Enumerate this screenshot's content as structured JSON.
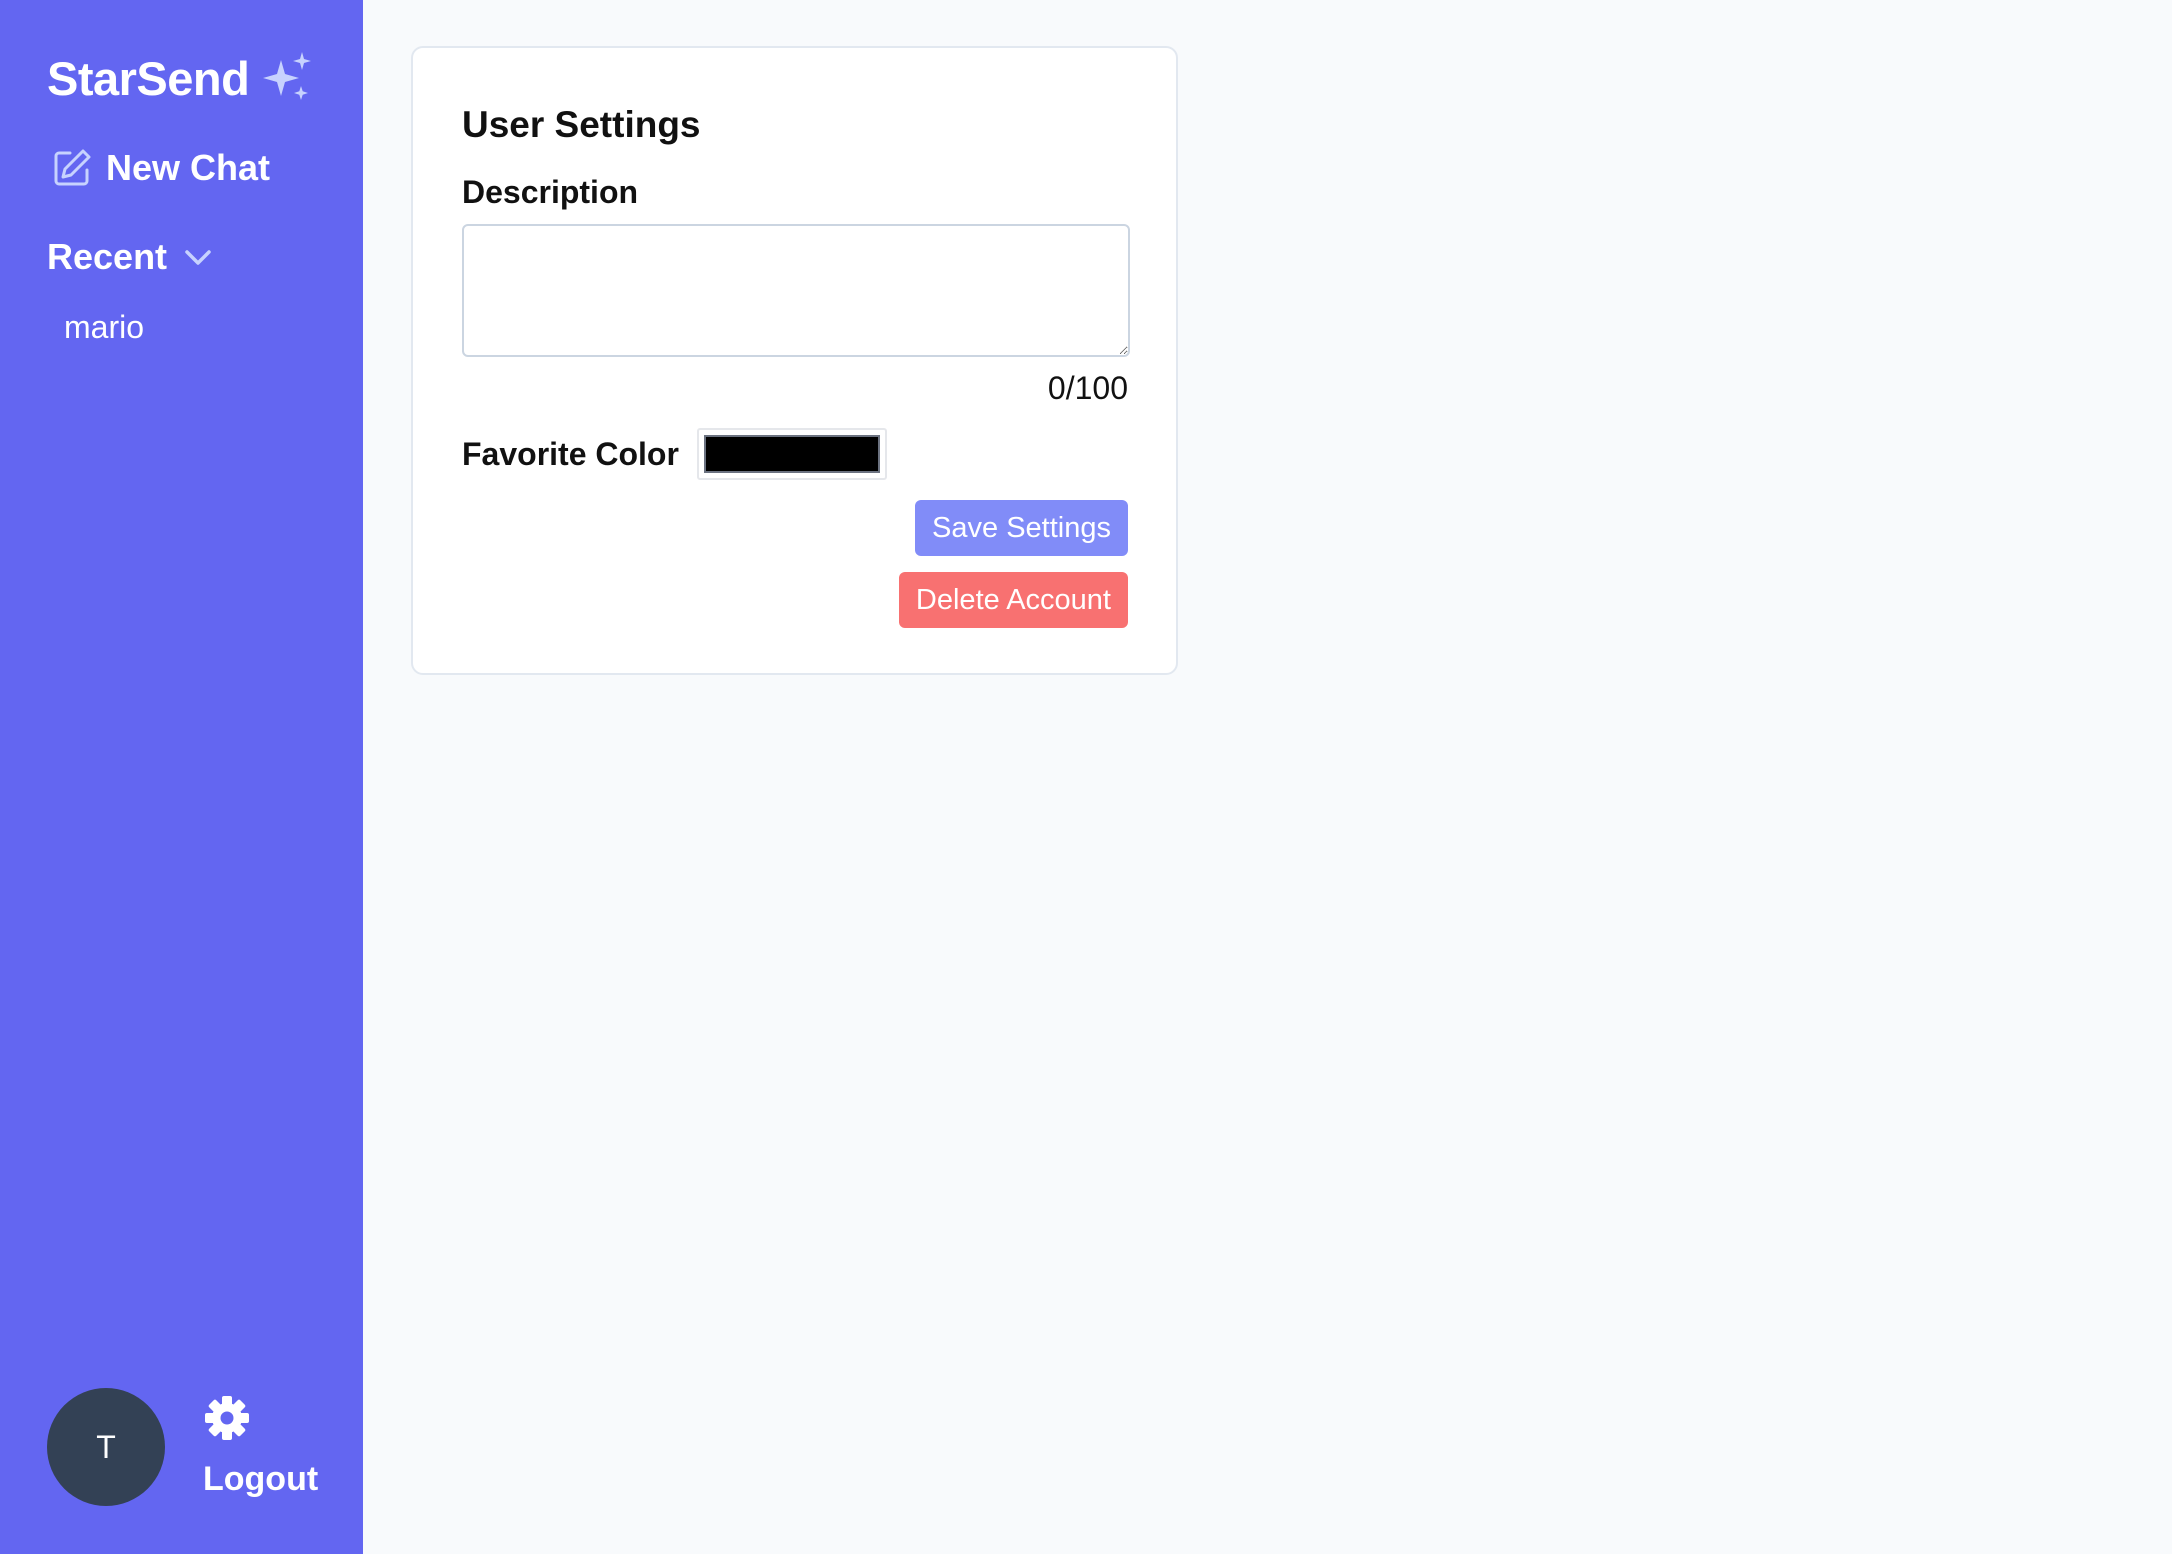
{
  "sidebar": {
    "brand": {
      "name": "StarSend",
      "icon": "sparkles-icon"
    },
    "new_chat": {
      "label": "New Chat",
      "icon": "edit-icon"
    },
    "recent": {
      "label": "Recent",
      "icon": "chevron-down-icon",
      "items": [
        {
          "label": "mario"
        }
      ]
    },
    "footer": {
      "avatar_initial": "T",
      "settings_icon": "gear-icon",
      "logout_label": "Logout"
    }
  },
  "settings": {
    "title": "User Settings",
    "description": {
      "label": "Description",
      "value": "",
      "placeholder": "",
      "counter": "0/100"
    },
    "favorite_color": {
      "label": "Favorite Color",
      "value": "#000000"
    },
    "save_label": "Save Settings",
    "delete_label": "Delete Account"
  },
  "colors": {
    "sidebar_bg": "#6366f1",
    "page_bg": "#f8fafc",
    "avatar_bg": "#334155",
    "save_button": "#818cf8",
    "delete_button": "#f87171",
    "sparkle_accent": "#c7d2fe"
  }
}
